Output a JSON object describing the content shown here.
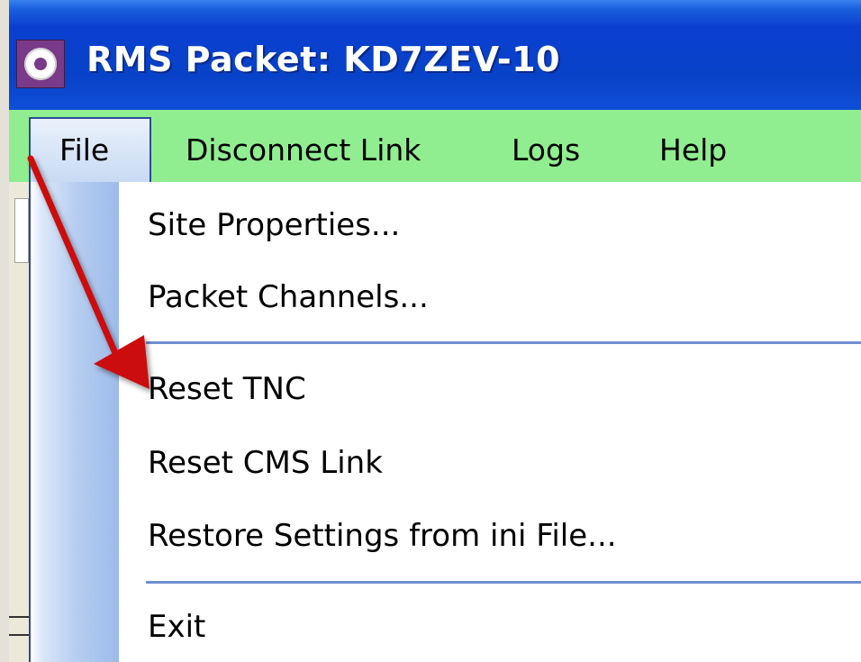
{
  "window": {
    "title": "RMS Packet: KD7ZEV-10",
    "icon": "app-ring-icon"
  },
  "menubar": {
    "items": [
      {
        "label": "File",
        "active": true
      },
      {
        "label": "Disconnect Link"
      },
      {
        "label": "Logs"
      },
      {
        "label": "Help"
      }
    ]
  },
  "file_menu": {
    "items": [
      {
        "label": "Site Properties..."
      },
      {
        "label": "Packet Channels..."
      },
      {
        "label": "Reset TNC"
      },
      {
        "label": "Reset CMS Link"
      },
      {
        "label": "Restore Settings from ini File..."
      },
      {
        "label": "Exit"
      }
    ]
  },
  "annotation": {
    "icon": "red-arrow-icon",
    "color": "#cc1010",
    "points_to": "Reset TNC"
  },
  "colors": {
    "titlebar": "#0a3fd0",
    "menubar": "#90ee90",
    "menu_highlight": "#c7daf3",
    "separator": "#6f8fcf"
  }
}
